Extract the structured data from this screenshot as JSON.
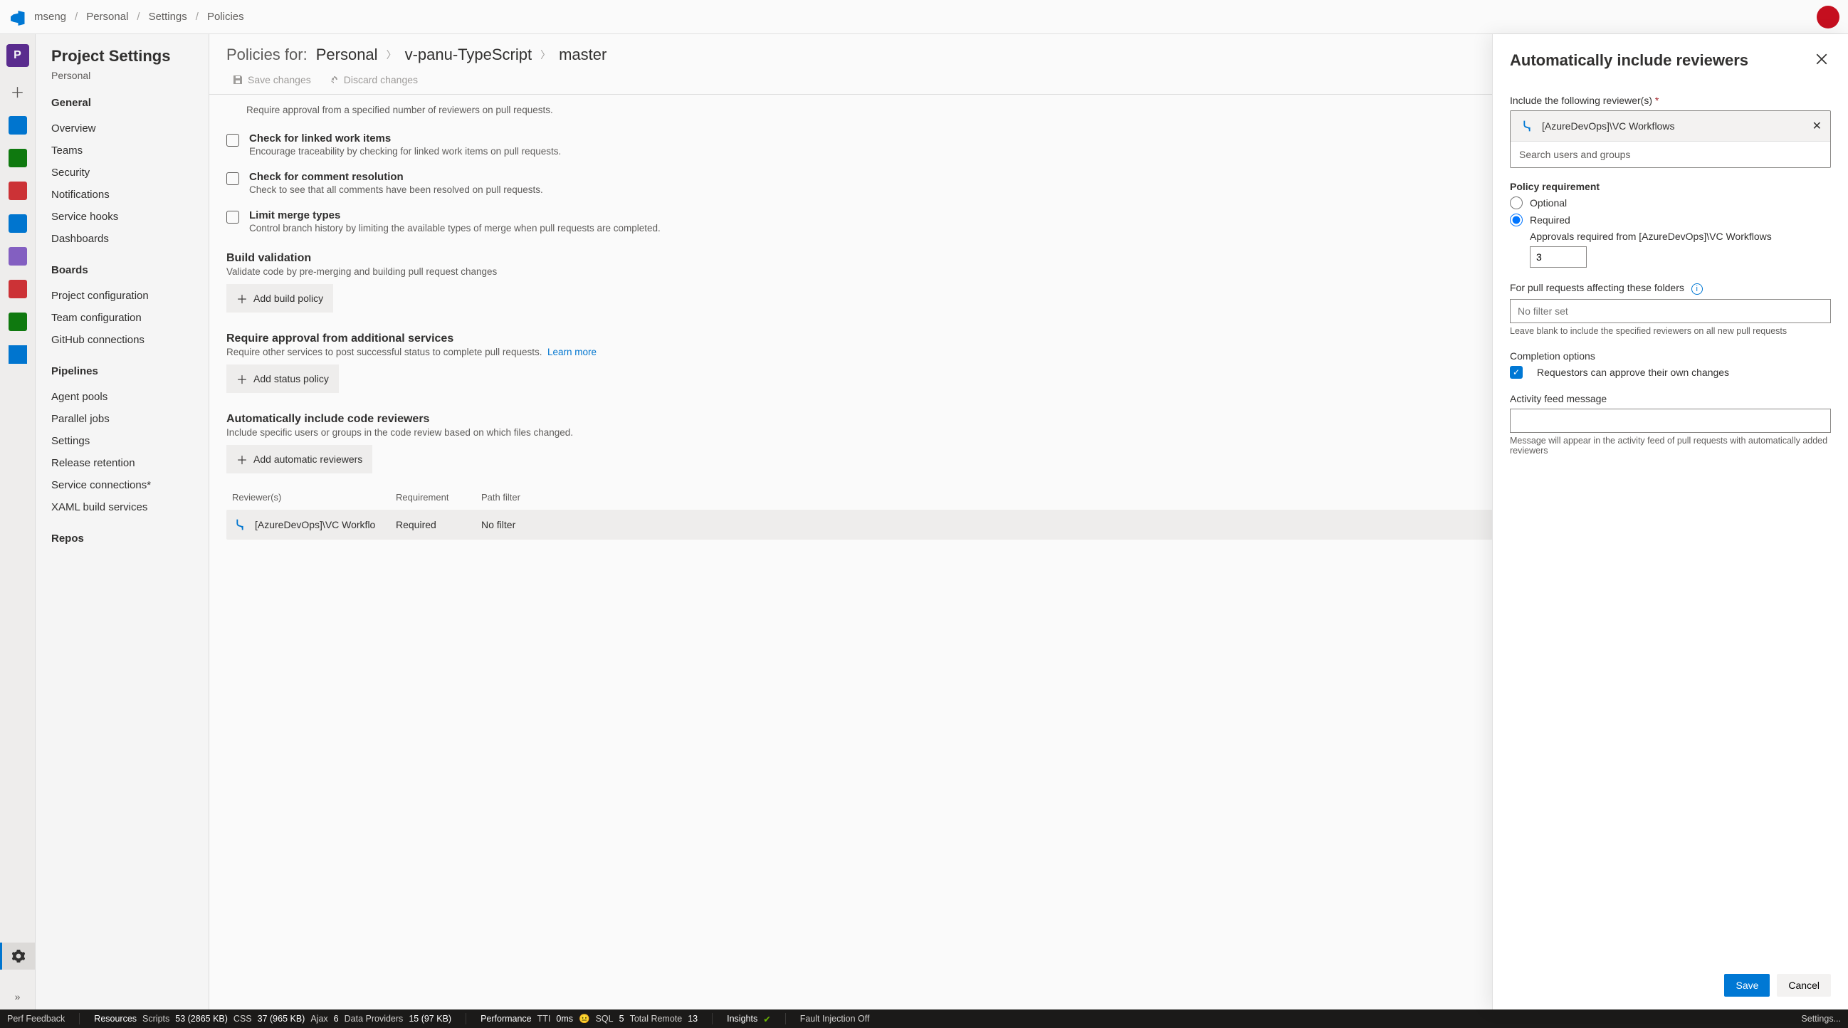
{
  "breadcrumbs": {
    "org": "mseng",
    "project": "Personal",
    "area": "Settings",
    "page": "Policies"
  },
  "sidebar": {
    "title": "Project Settings",
    "project": "Personal",
    "sections": [
      {
        "title": "General",
        "items": [
          "Overview",
          "Teams",
          "Security",
          "Notifications",
          "Service hooks",
          "Dashboards"
        ]
      },
      {
        "title": "Boards",
        "items": [
          "Project configuration",
          "Team configuration",
          "GitHub connections"
        ]
      },
      {
        "title": "Pipelines",
        "items": [
          "Agent pools",
          "Parallel jobs",
          "Settings",
          "Release retention",
          "Service connections*",
          "XAML build services"
        ]
      },
      {
        "title": "Repos",
        "items": []
      }
    ]
  },
  "policies": {
    "title_label": "Policies for:",
    "path": [
      "Personal",
      "v-panu-TypeScript",
      "master"
    ],
    "actions": {
      "save": "Save changes",
      "discard": "Discard changes"
    },
    "top_desc": "Require approval from a specified number of reviewers on pull requests.",
    "checks": [
      {
        "title": "Check for linked work items",
        "desc": "Encourage traceability by checking for linked work items on pull requests."
      },
      {
        "title": "Check for comment resolution",
        "desc": "Check to see that all comments have been resolved on pull requests."
      },
      {
        "title": "Limit merge types",
        "desc": "Control branch history by limiting the available types of merge when pull requests are completed."
      }
    ],
    "build_validation": {
      "title": "Build validation",
      "desc": "Validate code by pre-merging and building pull request changes",
      "button": "Add build policy"
    },
    "require_services": {
      "title": "Require approval from additional services",
      "desc": "Require other services to post successful status to complete pull requests.",
      "learn": "Learn more",
      "button": "Add status policy"
    },
    "auto_reviewers": {
      "title": "Automatically include code reviewers",
      "desc": "Include specific users or groups in the code review based on which files changed.",
      "button": "Add automatic reviewers",
      "columns": {
        "reviewers": "Reviewer(s)",
        "req": "Requirement",
        "path": "Path filter"
      },
      "rows": [
        {
          "name": "[AzureDevOps]\\VC Workflo",
          "req": "Required",
          "path": "No filter"
        }
      ]
    }
  },
  "panel": {
    "title": "Automatically include reviewers",
    "include_label": "Include the following reviewer(s)",
    "chip": "[AzureDevOps]\\VC Workflows",
    "search_placeholder": "Search users and groups",
    "policy_req_label": "Policy requirement",
    "optional": "Optional",
    "required": "Required",
    "approvals_label": "Approvals required from [AzureDevOps]\\VC Workflows",
    "approvals_value": "3",
    "folders_label": "For pull requests affecting these folders",
    "folders_placeholder": "No filter set",
    "folders_hint": "Leave blank to include the specified reviewers on all new pull requests",
    "completion_label": "Completion options",
    "completion_check": "Requestors can approve their own changes",
    "activity_label": "Activity feed message",
    "activity_hint": "Message will appear in the activity feed of pull requests with automatically added reviewers",
    "save": "Save",
    "cancel": "Cancel"
  },
  "status": {
    "perf": "Perf Feedback",
    "resources": "Resources",
    "scripts_lbl": "Scripts",
    "scripts": "53 (2865 KB)",
    "css_lbl": "CSS",
    "css": "37 (965 KB)",
    "ajax_lbl": "Ajax",
    "ajax": "6",
    "dp_lbl": "Data Providers",
    "dp": "15 (97 KB)",
    "performance": "Performance",
    "tti_lbl": "TTI",
    "tti": "0ms",
    "sql_lbl": "SQL",
    "sql": "5",
    "tr_lbl": "Total Remote",
    "tr": "13",
    "insights": "Insights",
    "fault": "Fault Injection Off",
    "settings": "Settings..."
  }
}
